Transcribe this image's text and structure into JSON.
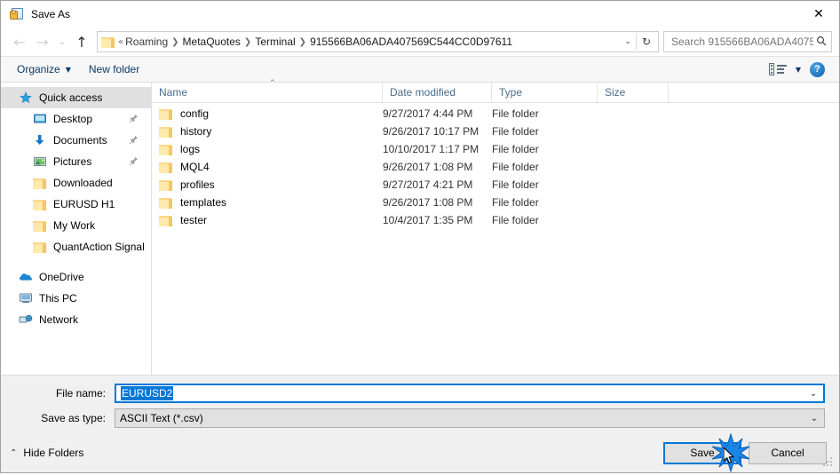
{
  "window": {
    "title": "Save As",
    "icon": "save-as-icon",
    "close_label": "✕"
  },
  "navigation": {
    "back_label": "←",
    "forward_label": "→",
    "recent_label": "⌄",
    "up_label": "↑",
    "address": {
      "folder_icon": "folder-icon",
      "overflow_label": "«",
      "crumbs": [
        "Roaming",
        "MetaQuotes",
        "Terminal",
        "915566BA06ADA407569C544CC0D97611"
      ],
      "separator": "❯",
      "dropdown_label": "⌄",
      "refresh_label": "↻"
    },
    "search": {
      "placeholder": "Search 915566BA06ADA40756...",
      "value": "",
      "icon": "search-icon"
    }
  },
  "toolbar": {
    "organize_label": "Organize",
    "organize_caret": "▼",
    "new_folder_label": "New folder",
    "view_icon": "view-layout-icon",
    "view_caret": "▼",
    "help_label": "?"
  },
  "sidebar": {
    "items": [
      {
        "label": "Quick access",
        "icon": "star-pin-icon",
        "selected": true,
        "level": "root",
        "pinned": false
      },
      {
        "label": "Desktop",
        "icon": "desktop-icon",
        "selected": false,
        "level": "child",
        "pinned": true
      },
      {
        "label": "Documents",
        "icon": "documents-icon",
        "selected": false,
        "level": "child",
        "pinned": true
      },
      {
        "label": "Pictures",
        "icon": "pictures-icon",
        "selected": false,
        "level": "child",
        "pinned": true
      },
      {
        "label": "Downloaded",
        "icon": "folder-icon",
        "selected": false,
        "level": "child",
        "pinned": false
      },
      {
        "label": "EURUSD H1",
        "icon": "folder-icon",
        "selected": false,
        "level": "child",
        "pinned": false
      },
      {
        "label": "My Work",
        "icon": "folder-icon",
        "selected": false,
        "level": "child",
        "pinned": false
      },
      {
        "label": "QuantAction Signal",
        "icon": "folder-icon",
        "selected": false,
        "level": "child",
        "pinned": false
      },
      {
        "label": "OneDrive",
        "icon": "onedrive-icon",
        "selected": false,
        "level": "root",
        "pinned": false
      },
      {
        "label": "This PC",
        "icon": "this-pc-icon",
        "selected": false,
        "level": "root",
        "pinned": false
      },
      {
        "label": "Network",
        "icon": "network-icon",
        "selected": false,
        "level": "root",
        "pinned": false
      }
    ],
    "pin_glyph": "📌"
  },
  "filelist": {
    "columns": [
      "Name",
      "Date modified",
      "Type",
      "Size"
    ],
    "sort_caret": "⌃",
    "rows": [
      {
        "name": "config",
        "date": "9/27/2017 4:44 PM",
        "type": "File folder",
        "size": ""
      },
      {
        "name": "history",
        "date": "9/26/2017 10:17 PM",
        "type": "File folder",
        "size": ""
      },
      {
        "name": "logs",
        "date": "10/10/2017 1:17 PM",
        "type": "File folder",
        "size": ""
      },
      {
        "name": "MQL4",
        "date": "9/26/2017 1:08 PM",
        "type": "File folder",
        "size": ""
      },
      {
        "name": "profiles",
        "date": "9/27/2017 4:21 PM",
        "type": "File folder",
        "size": ""
      },
      {
        "name": "templates",
        "date": "9/26/2017 1:08 PM",
        "type": "File folder",
        "size": ""
      },
      {
        "name": "tester",
        "date": "10/4/2017 1:35 PM",
        "type": "File folder",
        "size": ""
      }
    ]
  },
  "form": {
    "file_name_label": "File name:",
    "file_name_value": "EURUSD2",
    "file_name_chevron": "⌄",
    "save_as_type_label": "Save as type:",
    "save_as_type_value": "ASCII Text (*.csv)",
    "save_as_type_chevron": "⌄"
  },
  "footer": {
    "hide_folders_label": "Hide Folders",
    "hide_folders_caret": "⌃",
    "save_label": "Save",
    "cancel_label": "Cancel"
  },
  "colors": {
    "accent": "#0078d7",
    "folder": "#fcd888",
    "header_text": "#4a6d8c",
    "toolbar_text": "#0b3a64"
  }
}
